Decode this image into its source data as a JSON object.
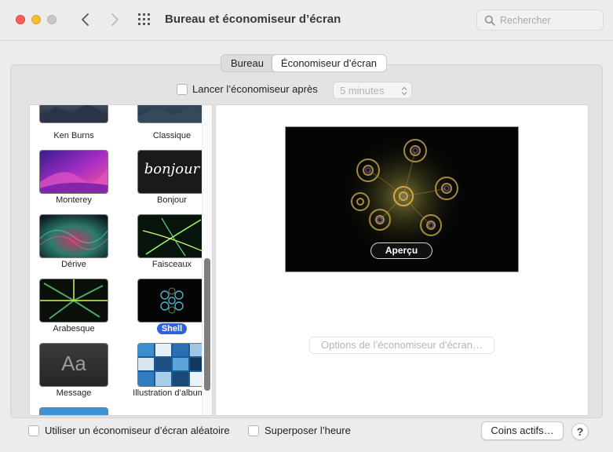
{
  "window": {
    "title": "Bureau et économiseur d’écran",
    "search_placeholder": "Rechercher"
  },
  "tabs": [
    {
      "label": "Bureau",
      "active": false
    },
    {
      "label": "Économiseur d’écran",
      "active": true
    }
  ],
  "start_after": {
    "label": "Lancer l’économiseur après",
    "checked": false,
    "value": "5 minutes"
  },
  "savers": [
    {
      "label": "Ken Burns",
      "icon": "ken-burns-thumbnail"
    },
    {
      "label": "Classique",
      "icon": "classique-thumbnail"
    },
    {
      "label": "Monterey",
      "icon": "monterey-thumbnail"
    },
    {
      "label": "Bonjour",
      "icon": "bonjour-thumbnail",
      "thumb_text": "bonjour"
    },
    {
      "label": "Dérive",
      "icon": "derive-thumbnail"
    },
    {
      "label": "Faisceaux",
      "icon": "faisceaux-thumbnail"
    },
    {
      "label": "Arabesque",
      "icon": "arabesque-thumbnail"
    },
    {
      "label": "Shell",
      "icon": "shell-thumbnail",
      "selected": true
    },
    {
      "label": "Message",
      "icon": "message-thumbnail",
      "thumb_text": "Aa"
    },
    {
      "label": "Illustration d’album",
      "icon": "album-artwork-thumbnail"
    }
  ],
  "preview": {
    "button_label": "Aperçu",
    "options_label": "Options de l’économiseur d’écran…"
  },
  "bottom": {
    "random_label": "Utiliser un économiseur d’écran aléatoire",
    "clock_label": "Superposer l’heure",
    "hot_corners_label": "Coins actifs…",
    "help_label": "?"
  },
  "colors": {
    "selection": "#2e62d9",
    "close": "#fe5f57",
    "minimize": "#febc2e"
  }
}
